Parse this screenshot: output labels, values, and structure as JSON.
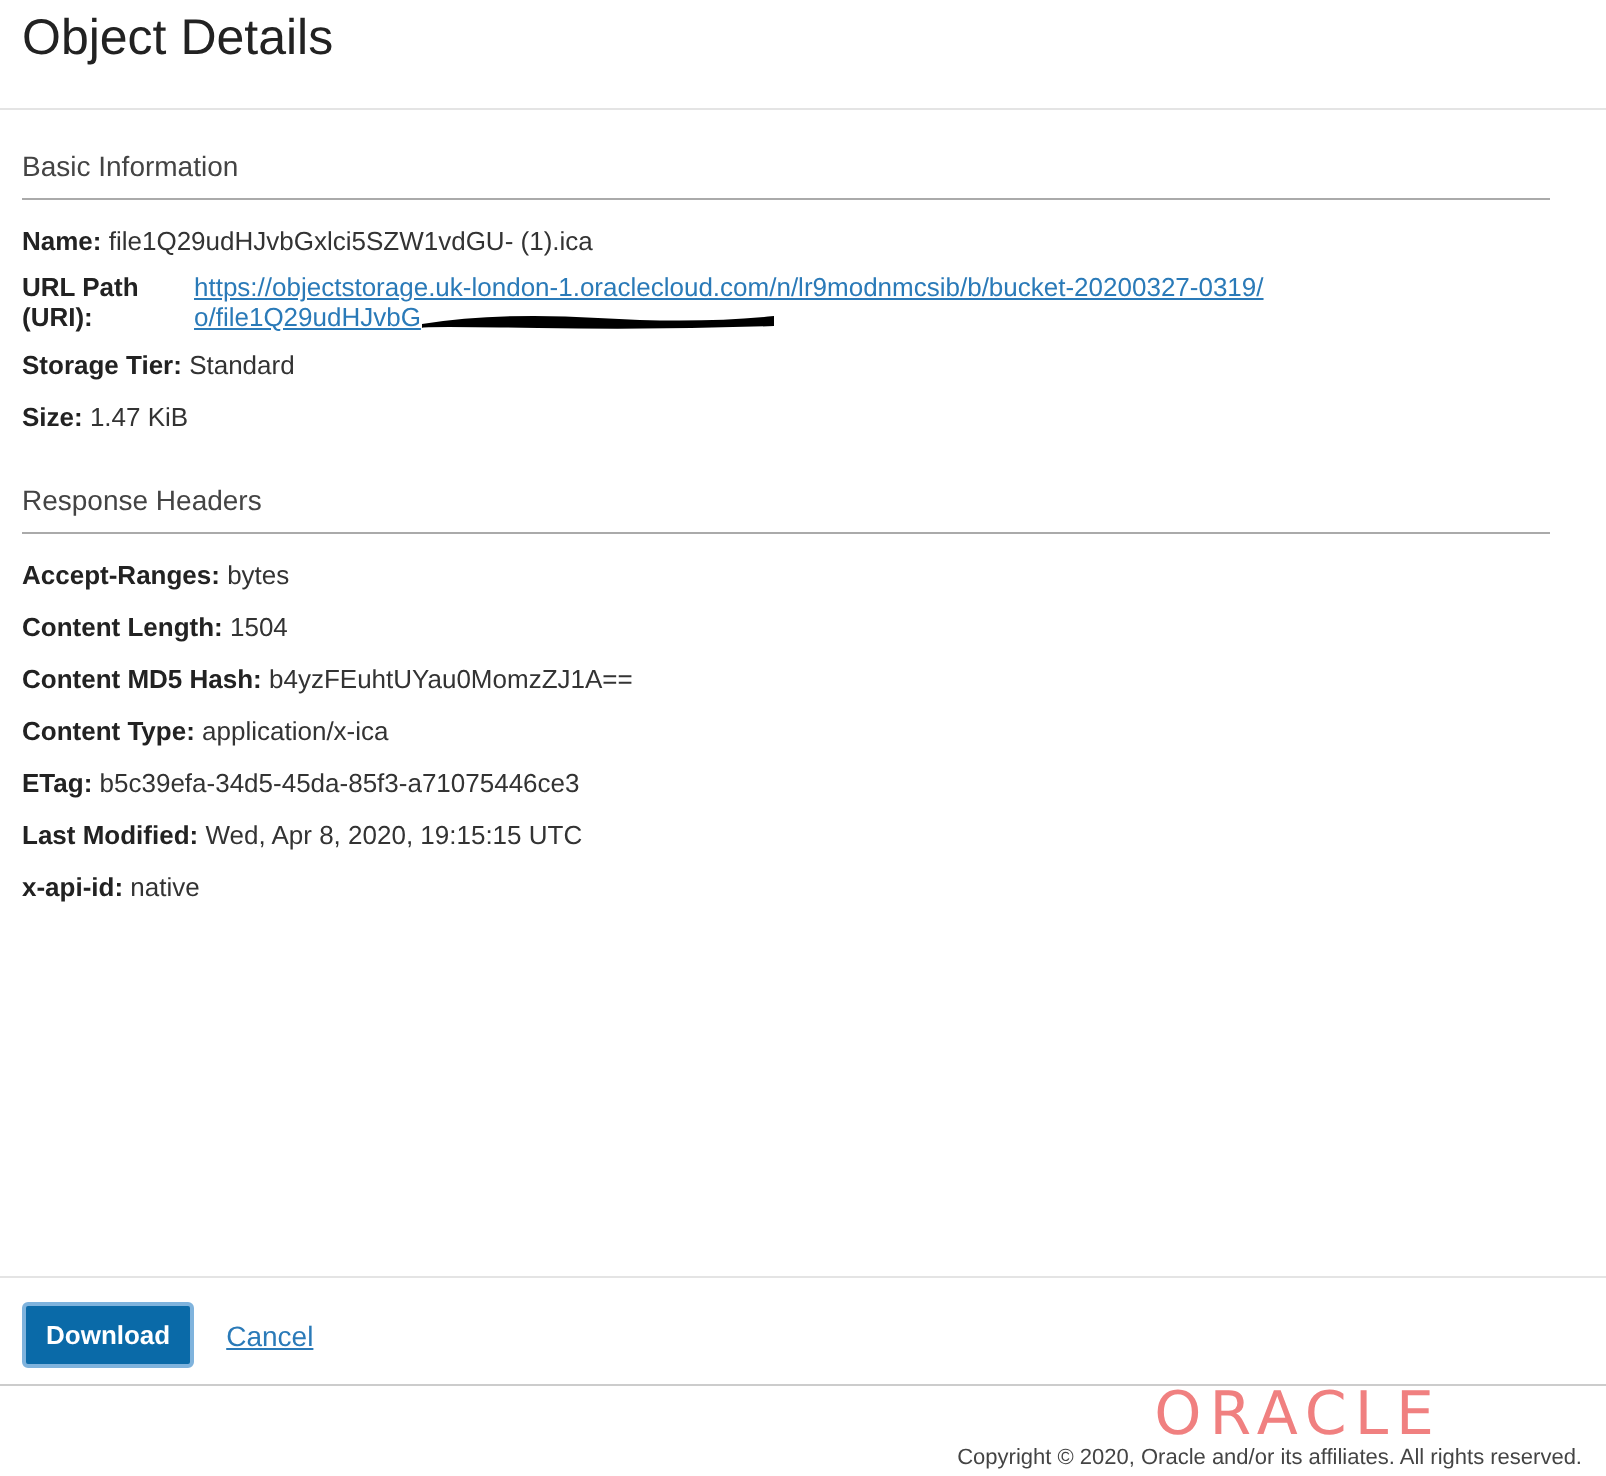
{
  "title": "Object Details",
  "sections": [
    {
      "heading": "Basic Information",
      "fields": [
        {
          "kind": "text",
          "label": "Name:",
          "value": "file1Q29udHJvbGxlci5SZW1vdGU- (1).ica"
        },
        {
          "kind": "link",
          "label": "URL Path (URI):",
          "value": "https://objectstorage.uk-london-1.oraclecloud.com/n/lr9modnmcsib/b/bucket-20200327-0319/o/file1Q29udHJvbG",
          "redacted": true
        },
        {
          "kind": "text",
          "label": "Storage Tier:",
          "value": "Standard"
        },
        {
          "kind": "text",
          "label": "Size:",
          "value": "1.47 KiB"
        }
      ]
    },
    {
      "heading": "Response Headers",
      "fields": [
        {
          "kind": "text",
          "label": "Accept-Ranges:",
          "value": "bytes"
        },
        {
          "kind": "text",
          "label": "Content Length:",
          "value": "1504"
        },
        {
          "kind": "text",
          "label": "Content MD5 Hash:",
          "value": "b4yzFEuhtUYau0MomzZJ1A=="
        },
        {
          "kind": "text",
          "label": "Content Type:",
          "value": "application/x-ica"
        },
        {
          "kind": "text",
          "label": "ETag:",
          "value": "b5c39efa-34d5-45da-85f3-a71075446ce3"
        },
        {
          "kind": "text",
          "label": "Last Modified:",
          "value": "Wed, Apr 8, 2020, 19:15:15 UTC"
        },
        {
          "kind": "text",
          "label": "x-api-id:",
          "value": "native"
        }
      ]
    }
  ],
  "buttons": [
    {
      "kind": "primary",
      "label": "Download"
    },
    {
      "kind": "link",
      "label": "Cancel"
    }
  ],
  "footer": {
    "logo": "ORACLE",
    "copyright": "Copyright © 2020, Oracle and/or its affiliates. All rights reserved."
  }
}
